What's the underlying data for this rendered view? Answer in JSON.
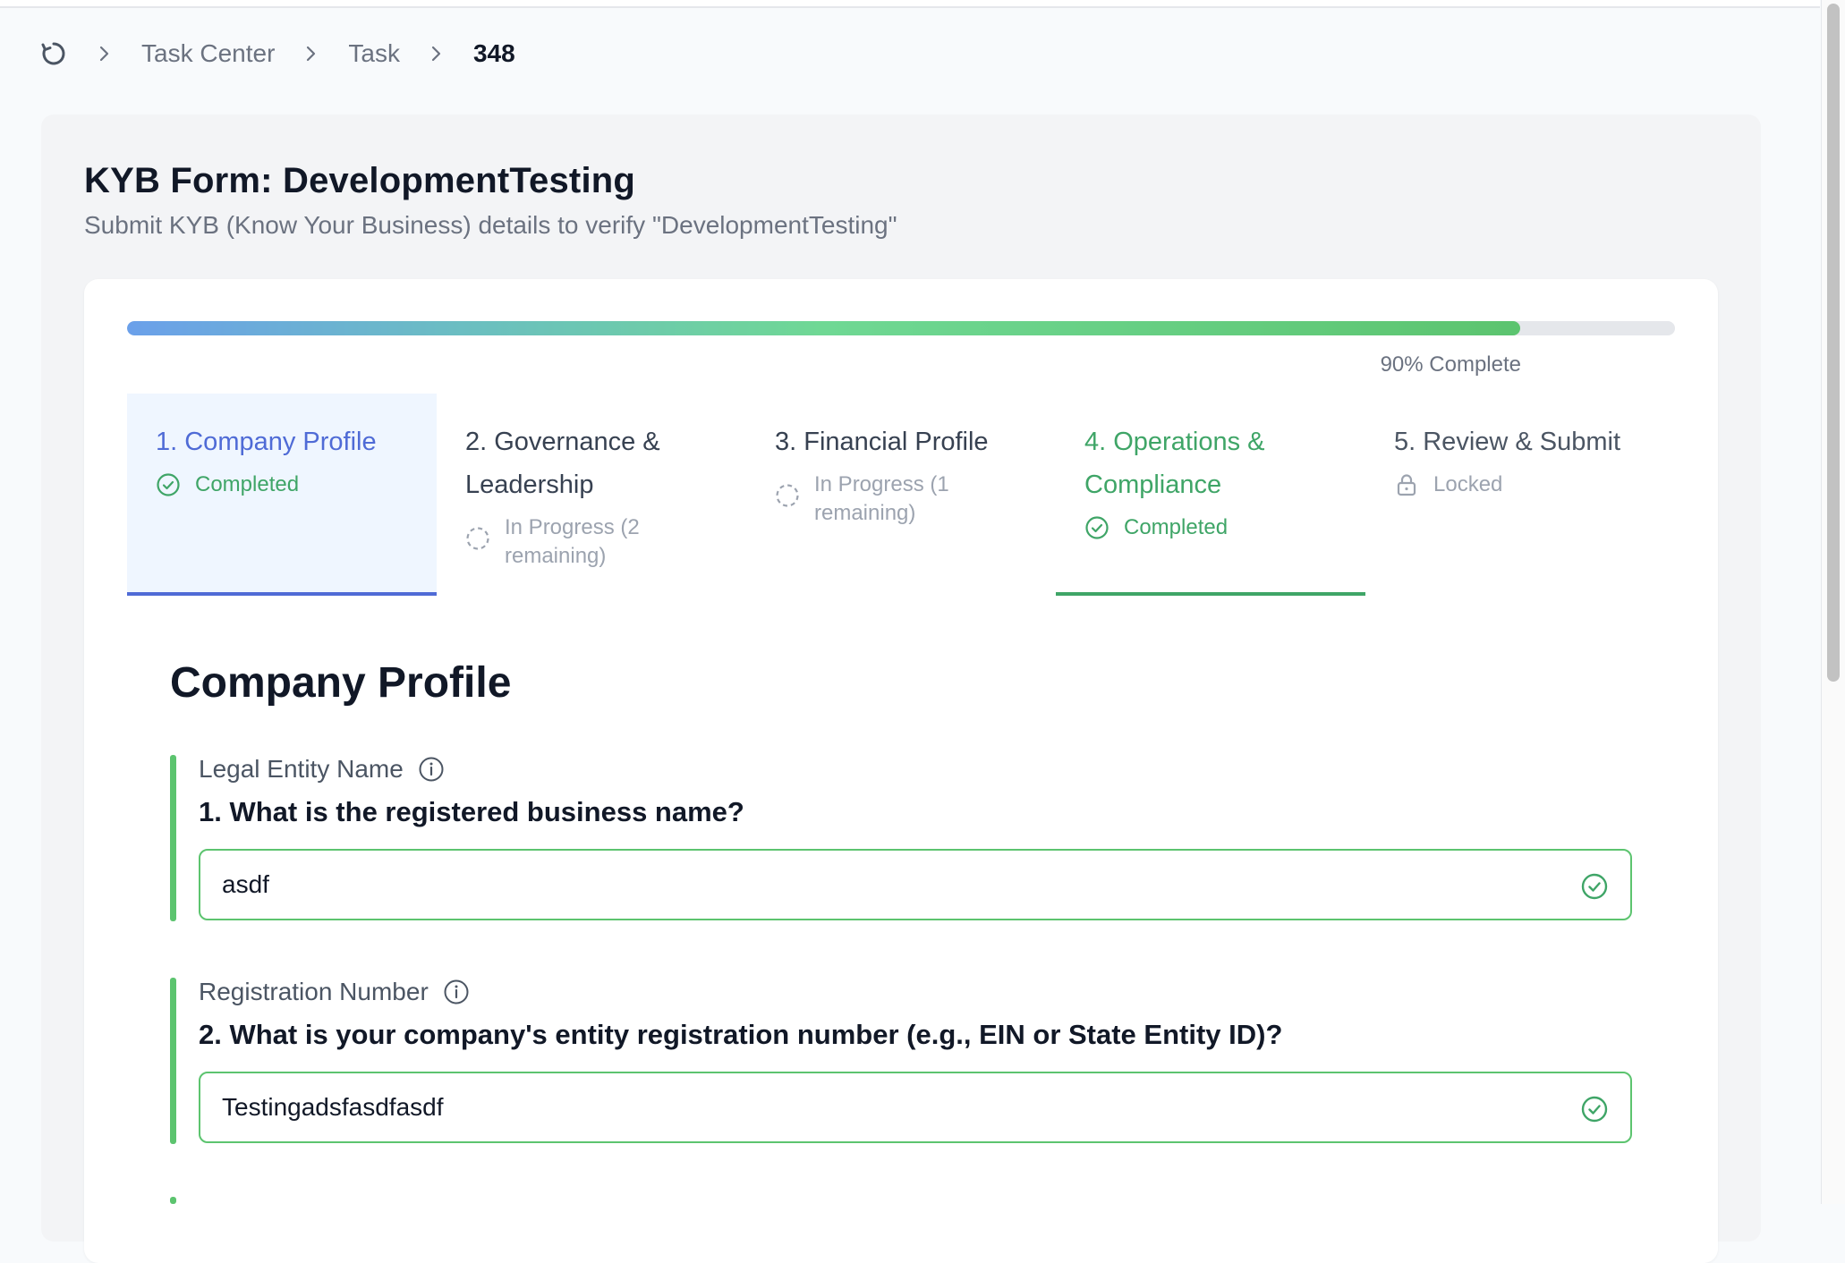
{
  "breadcrumb": {
    "items": [
      "Task Center",
      "Task"
    ],
    "current": "348"
  },
  "header": {
    "title": "KYB Form: DevelopmentTesting",
    "subtitle": "Submit KYB (Know Your Business) details to verify \"DevelopmentTesting\""
  },
  "progress": {
    "percent": 90,
    "label": "90% Complete"
  },
  "steps": [
    {
      "label": "1. Company Profile",
      "status": "Completed",
      "state": "completed",
      "active": true
    },
    {
      "label": "2. Governance & Leadership",
      "status": "In Progress (2 remaining)",
      "state": "in-progress",
      "active": false
    },
    {
      "label": "3. Financial Profile",
      "status": "In Progress (1 remaining)",
      "state": "in-progress",
      "active": false
    },
    {
      "label": "4. Operations & Compliance",
      "status": "Completed",
      "state": "completed",
      "active": false
    },
    {
      "label": "5. Review & Submit",
      "status": "Locked",
      "state": "locked",
      "active": false
    }
  ],
  "section": {
    "title": "Company Profile",
    "questions": [
      {
        "field_label": "Legal Entity Name",
        "question": "1. What is the registered business name?",
        "answer": "asdf"
      },
      {
        "field_label": "Registration Number",
        "question": "2. What is your company's entity registration number (e.g., EIN or State Entity ID)?",
        "answer": "Testingadsfasdfasdf"
      }
    ]
  },
  "colors": {
    "accent_blue": "#4f6bd6",
    "success_green": "#3fa567",
    "field_border_green": "#5cc46f"
  },
  "icons": {
    "home": "refresh-circle-icon",
    "separator": "chevron-right-icon",
    "completed": "check-circle-icon",
    "in_progress": "dashed-circle-icon",
    "locked": "lock-icon",
    "info": "info-icon"
  }
}
